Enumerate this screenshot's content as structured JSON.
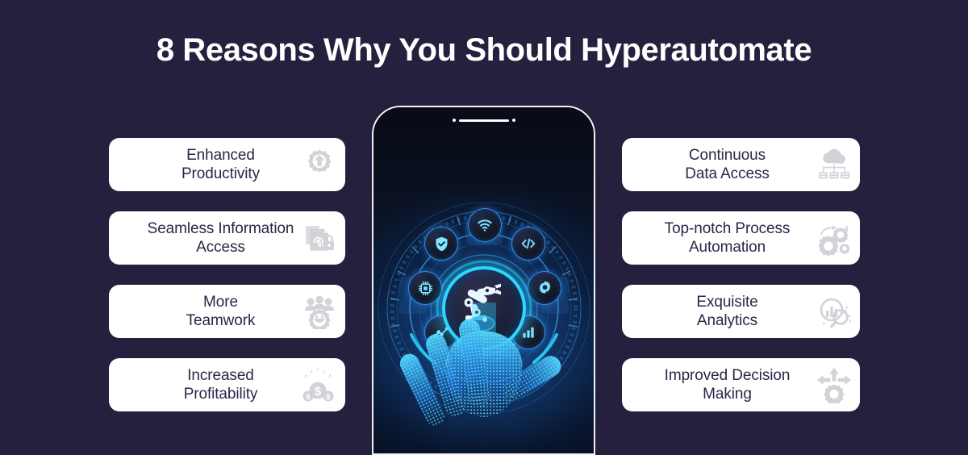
{
  "page": {
    "title": "8 Reasons Why You Should Hyperautomate",
    "background_color": "#25203e",
    "card_background_color": "#ffffff",
    "card_text_color": "#2b2747",
    "card_icon_color": "#d2d2d8",
    "accent_glow_color": "#2ad8ff"
  },
  "left_column": {
    "cards": [
      {
        "label": "Enhanced\nProductivity",
        "line1": "Enhanced",
        "line2": "Productivity",
        "icon": "gear-up-arrow-icon"
      },
      {
        "label": "Seamless Information\nAccess",
        "line1": "Seamless Information",
        "line2": "Access",
        "icon": "document-fingerprint-lock-icon"
      },
      {
        "label": "More\nTeamwork",
        "line1": "More",
        "line2": "Teamwork",
        "icon": "team-gear-icon"
      },
      {
        "label": "Increased\nProfitability",
        "line1": "Increased",
        "line2": "Profitability",
        "icon": "dollar-coins-up-arrows-icon"
      }
    ]
  },
  "right_column": {
    "cards": [
      {
        "label": "Continuous\nData Access",
        "line1": "Continuous",
        "line2": "Data Access",
        "icon": "cloud-servers-icon"
      },
      {
        "label": "Top-notch Process\nAutomation",
        "line1": "Top-notch Process",
        "line2": "Automation",
        "icon": "gears-cycle-icon"
      },
      {
        "label": "Exquisite\nAnalytics",
        "line1": "Exquisite",
        "line2": "Analytics",
        "icon": "magnifier-bar-chart-icon"
      },
      {
        "label": "Improved Decision\nMaking",
        "line1": "Improved Decision",
        "line2": "Making",
        "icon": "gear-arrows-icon"
      }
    ]
  },
  "phone": {
    "device": "smartphone-illustration",
    "frame_color": "#f2f2f5",
    "screen_scene": "hyperautomation-hud-with-digital-hand",
    "center_icon": "robotic-arm-icon",
    "orbit_icons": [
      {
        "name": "wifi-icon",
        "position": "top"
      },
      {
        "name": "code-brackets-icon",
        "position": "upper-right"
      },
      {
        "name": "gear-icon",
        "position": "right"
      },
      {
        "name": "bar-chart-icon",
        "position": "lower-right"
      },
      {
        "name": "line-chart-icon",
        "position": "lower-left"
      },
      {
        "name": "cpu-chip-icon",
        "position": "left"
      },
      {
        "name": "shield-check-icon",
        "position": "upper-left"
      }
    ],
    "hand": "digital-wireframe-hand"
  }
}
